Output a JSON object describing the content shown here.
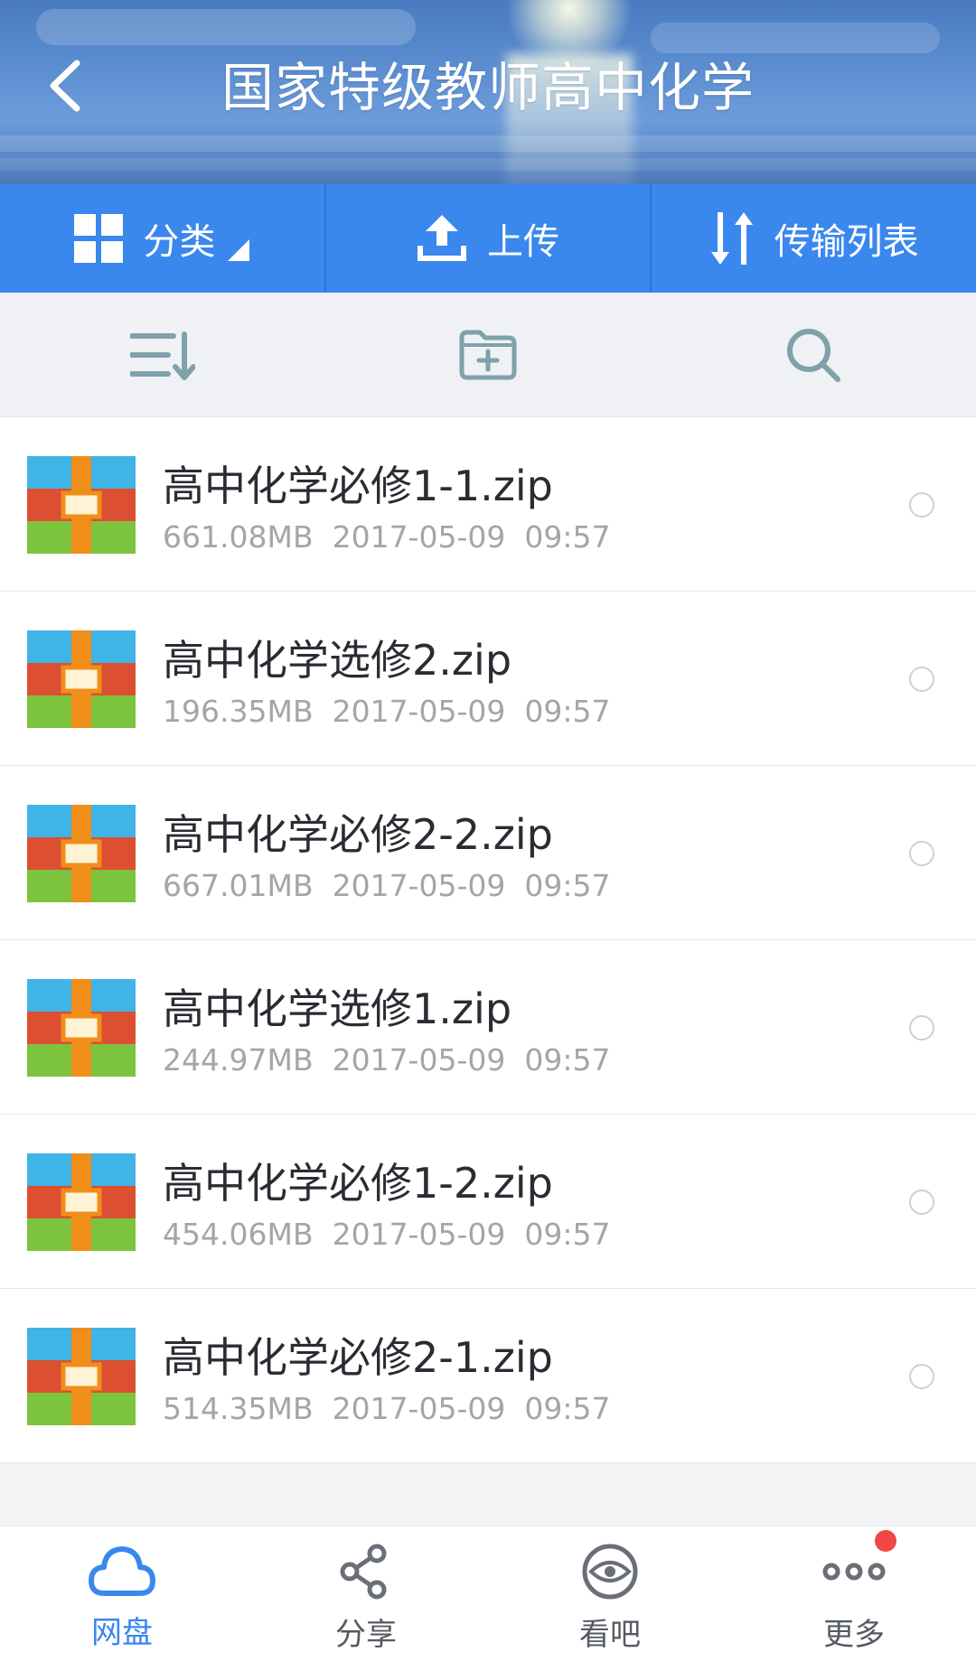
{
  "header": {
    "title": "国家特级教师高中化学",
    "back_icon": "chevron-left-icon"
  },
  "action_bar": {
    "category_label": "分类",
    "upload_label": "上传",
    "transfer_label": "传输列表",
    "accent_color": "#3a87ee"
  },
  "toolbar": {
    "sort_icon": "sort-icon",
    "new_folder_icon": "folder-plus-icon",
    "search_icon": "search-icon"
  },
  "files": [
    {
      "name": "高中化学必修1-1.zip",
      "size": "661.08MB",
      "date": "2017-05-09",
      "time": "09:57"
    },
    {
      "name": "高中化学选修2.zip",
      "size": "196.35MB",
      "date": "2017-05-09",
      "time": "09:57"
    },
    {
      "name": "高中化学必修2-2.zip",
      "size": "667.01MB",
      "date": "2017-05-09",
      "time": "09:57"
    },
    {
      "name": "高中化学选修1.zip",
      "size": "244.97MB",
      "date": "2017-05-09",
      "time": "09:57"
    },
    {
      "name": "高中化学必修1-2.zip",
      "size": "454.06MB",
      "date": "2017-05-09",
      "time": "09:57"
    },
    {
      "name": "高中化学必修2-1.zip",
      "size": "514.35MB",
      "date": "2017-05-09",
      "time": "09:57"
    }
  ],
  "bottom_nav": {
    "items": [
      {
        "label": "网盘",
        "icon": "cloud-icon",
        "active": true
      },
      {
        "label": "分享",
        "icon": "share-icon",
        "active": false
      },
      {
        "label": "看吧",
        "icon": "eye-icon",
        "active": false
      },
      {
        "label": "更多",
        "icon": "more-icon",
        "active": false,
        "badge": true
      }
    ],
    "badge_color": "#f04646"
  }
}
